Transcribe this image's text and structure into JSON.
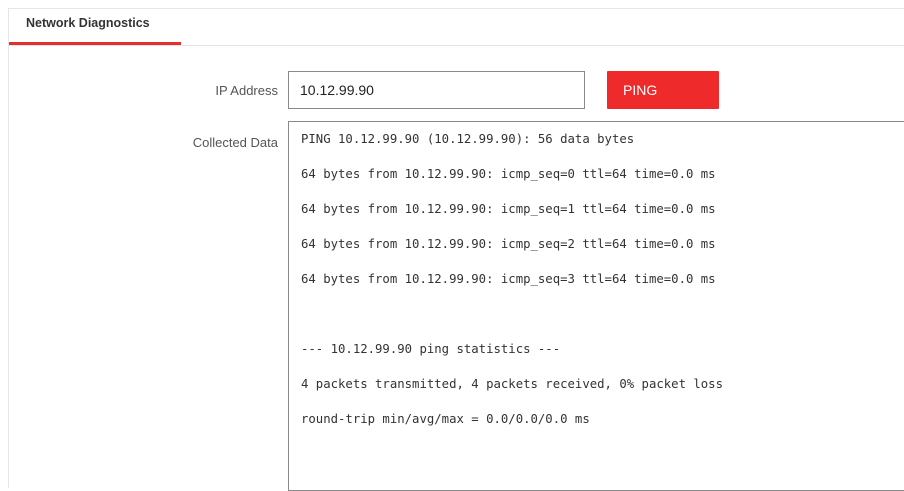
{
  "tabs": [
    {
      "label": "Network Diagnostics",
      "active": true
    }
  ],
  "form": {
    "ip_label": "IP Address",
    "ip_value": "10.12.99.90",
    "ping_label": "PING",
    "data_label": "Collected Data"
  },
  "output_lines": [
    "PING 10.12.99.90 (10.12.99.90): 56 data bytes",
    "64 bytes from 10.12.99.90: icmp_seq=0 ttl=64 time=0.0 ms",
    "64 bytes from 10.12.99.90: icmp_seq=1 ttl=64 time=0.0 ms",
    "64 bytes from 10.12.99.90: icmp_seq=2 ttl=64 time=0.0 ms",
    "64 bytes from 10.12.99.90: icmp_seq=3 ttl=64 time=0.0 ms",
    "",
    "--- 10.12.99.90 ping statistics ---",
    "4 packets transmitted, 4 packets received, 0% packet loss",
    "round-trip min/avg/max = 0.0/0.0/0.0 ms"
  ],
  "colors": {
    "accent": "#ee2a2a",
    "tab_underline": "#e62e2e"
  }
}
